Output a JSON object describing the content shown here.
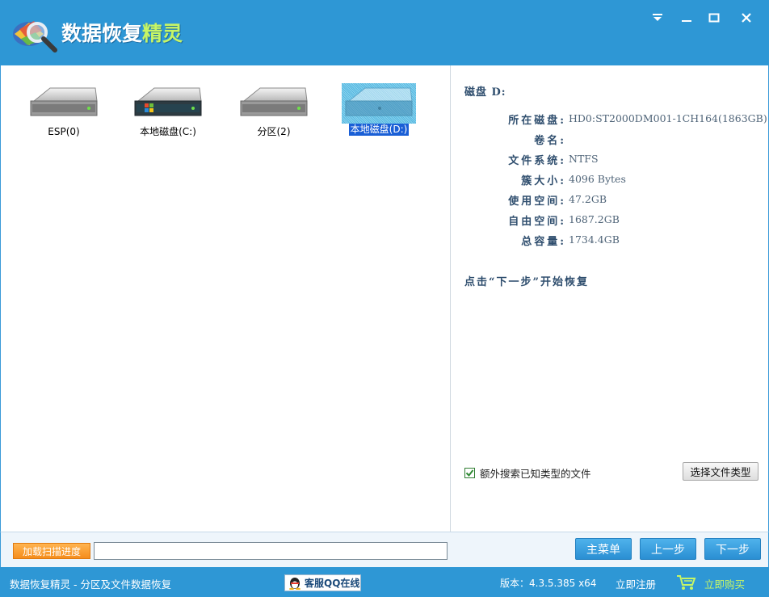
{
  "app": {
    "title_main": "数据恢复",
    "title_accent": "精灵"
  },
  "window_controls": [
    "menu-icon",
    "minimize-icon",
    "maximize-icon",
    "close-icon"
  ],
  "drives": [
    {
      "label": "ESP(0)",
      "type": "plain",
      "selected": false
    },
    {
      "label": "本地磁盘(C:)",
      "type": "windows",
      "selected": false
    },
    {
      "label": "分区(2)",
      "type": "plain",
      "selected": false
    },
    {
      "label": "本地磁盘(D:)",
      "type": "plain",
      "selected": true
    }
  ],
  "info": {
    "title": "磁盘 D:",
    "rows": [
      {
        "key": "所在磁盘:",
        "value": "HD0:ST2000DM001-1CH164(1863GB)"
      },
      {
        "key": "卷名:",
        "value": ""
      },
      {
        "key": "文件系统:",
        "value": "NTFS"
      },
      {
        "key": "簇大小:",
        "value": "4096 Bytes"
      },
      {
        "key": "使用空间:",
        "value": "47.2GB"
      },
      {
        "key": "自由空间:",
        "value": "1687.2GB"
      },
      {
        "key": "总容量:",
        "value": "1734.4GB"
      }
    ],
    "hint": "点击“下一步”开始恢复",
    "extra_search_label": "额外搜索已知类型的文件",
    "extra_search_checked": true,
    "select_type_button": "选择文件类型"
  },
  "toolbar": {
    "load_progress": "加载扫描进度",
    "progress_value": "",
    "main_menu": "主菜单",
    "prev": "上一步",
    "next": "下一步"
  },
  "status": {
    "text": "数据恢复精灵 - 分区及文件数据恢复",
    "qq": "客服QQ在线",
    "version": "版本：4.3.5.385 x64",
    "register": "立即注册",
    "buy": "立即购买"
  },
  "colors": {
    "brand_blue": "#2e97d5",
    "accent_green": "#c6f566",
    "orange": "#f58d1c",
    "selection": "#1a5fd6"
  }
}
